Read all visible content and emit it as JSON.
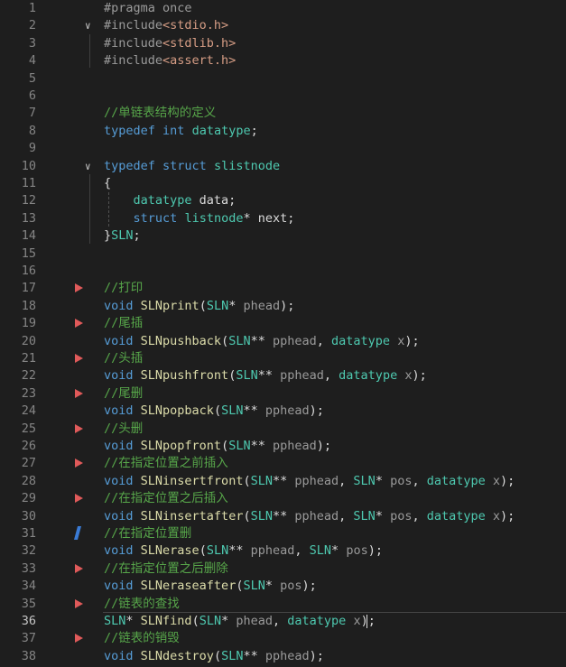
{
  "editor": {
    "current_line": 36,
    "lines": [
      {
        "n": "1",
        "tokens": [
          [
            "pp",
            "#pragma once"
          ]
        ]
      },
      {
        "n": "2",
        "fold": "open",
        "tokens": [
          [
            "pp",
            "#include"
          ],
          [
            "str",
            "<stdio.h>"
          ]
        ]
      },
      {
        "n": "3",
        "tokens": [
          [
            "pp",
            "#include"
          ],
          [
            "str",
            "<stdlib.h>"
          ]
        ]
      },
      {
        "n": "4",
        "tokens": [
          [
            "pp",
            "#include"
          ],
          [
            "str",
            "<assert.h>"
          ]
        ]
      },
      {
        "n": "5",
        "tokens": []
      },
      {
        "n": "6",
        "tokens": []
      },
      {
        "n": "7",
        "tokens": [
          [
            "cm",
            "//单链表结构的定义"
          ]
        ]
      },
      {
        "n": "8",
        "tokens": [
          [
            "kw",
            "typedef"
          ],
          [
            "vr",
            " "
          ],
          [
            "kw",
            "int"
          ],
          [
            "vr",
            " "
          ],
          [
            "ty",
            "datatype"
          ],
          [
            "vr",
            ";"
          ]
        ]
      },
      {
        "n": "9",
        "tokens": []
      },
      {
        "n": "10",
        "fold": "open",
        "tokens": [
          [
            "kw",
            "typedef"
          ],
          [
            "vr",
            " "
          ],
          [
            "kw",
            "struct"
          ],
          [
            "vr",
            " "
          ],
          [
            "ty",
            "slistnode"
          ]
        ]
      },
      {
        "n": "11",
        "tokens": [
          [
            "vr",
            "{"
          ]
        ]
      },
      {
        "n": "12",
        "tokens": [
          [
            "vr",
            "    "
          ],
          [
            "ty",
            "datatype"
          ],
          [
            "vr",
            " data;"
          ]
        ]
      },
      {
        "n": "13",
        "tokens": [
          [
            "vr",
            "    "
          ],
          [
            "kw",
            "struct"
          ],
          [
            "vr",
            " "
          ],
          [
            "ty",
            "listnode"
          ],
          [
            "vr",
            "* next;"
          ]
        ]
      },
      {
        "n": "14",
        "tokens": [
          [
            "vr",
            "}"
          ],
          [
            "ty",
            "SLN"
          ],
          [
            "vr",
            ";"
          ]
        ]
      },
      {
        "n": "15",
        "tokens": []
      },
      {
        "n": "16",
        "tokens": []
      },
      {
        "n": "17",
        "mark": "tri",
        "tokens": [
          [
            "cm",
            "//打印"
          ]
        ]
      },
      {
        "n": "18",
        "tokens": [
          [
            "kw",
            "void"
          ],
          [
            "vr",
            " "
          ],
          [
            "fn",
            "SLNprint"
          ],
          [
            "vr",
            "("
          ],
          [
            "ty",
            "SLN"
          ],
          [
            "vr",
            "* "
          ],
          [
            "pm",
            "phead"
          ],
          [
            "vr",
            ");"
          ]
        ]
      },
      {
        "n": "19",
        "mark": "tri",
        "tokens": [
          [
            "cm",
            "//尾插"
          ]
        ]
      },
      {
        "n": "20",
        "tokens": [
          [
            "kw",
            "void"
          ],
          [
            "vr",
            " "
          ],
          [
            "fn",
            "SLNpushback"
          ],
          [
            "vr",
            "("
          ],
          [
            "ty",
            "SLN"
          ],
          [
            "vr",
            "** "
          ],
          [
            "pm",
            "pphead"
          ],
          [
            "vr",
            ", "
          ],
          [
            "ty",
            "datatype"
          ],
          [
            "vr",
            " "
          ],
          [
            "pm",
            "x"
          ],
          [
            "vr",
            ");"
          ]
        ]
      },
      {
        "n": "21",
        "mark": "tri",
        "tokens": [
          [
            "cm",
            "//头插"
          ]
        ]
      },
      {
        "n": "22",
        "tokens": [
          [
            "kw",
            "void"
          ],
          [
            "vr",
            " "
          ],
          [
            "fn",
            "SLNpushfront"
          ],
          [
            "vr",
            "("
          ],
          [
            "ty",
            "SLN"
          ],
          [
            "vr",
            "** "
          ],
          [
            "pm",
            "pphead"
          ],
          [
            "vr",
            ", "
          ],
          [
            "ty",
            "datatype"
          ],
          [
            "vr",
            " "
          ],
          [
            "pm",
            "x"
          ],
          [
            "vr",
            ");"
          ]
        ]
      },
      {
        "n": "23",
        "mark": "tri",
        "tokens": [
          [
            "cm",
            "//尾删"
          ]
        ]
      },
      {
        "n": "24",
        "tokens": [
          [
            "kw",
            "void"
          ],
          [
            "vr",
            " "
          ],
          [
            "fn",
            "SLNpopback"
          ],
          [
            "vr",
            "("
          ],
          [
            "ty",
            "SLN"
          ],
          [
            "vr",
            "** "
          ],
          [
            "pm",
            "pphead"
          ],
          [
            "vr",
            ");"
          ]
        ]
      },
      {
        "n": "25",
        "mark": "tri",
        "tokens": [
          [
            "cm",
            "//头删"
          ]
        ]
      },
      {
        "n": "26",
        "tokens": [
          [
            "kw",
            "void"
          ],
          [
            "vr",
            " "
          ],
          [
            "fn",
            "SLNpopfront"
          ],
          [
            "vr",
            "("
          ],
          [
            "ty",
            "SLN"
          ],
          [
            "vr",
            "** "
          ],
          [
            "pm",
            "pphead"
          ],
          [
            "vr",
            ");"
          ]
        ]
      },
      {
        "n": "27",
        "mark": "tri",
        "tokens": [
          [
            "cm",
            "//在指定位置之前插入"
          ]
        ]
      },
      {
        "n": "28",
        "tokens": [
          [
            "kw",
            "void"
          ],
          [
            "vr",
            " "
          ],
          [
            "fn",
            "SLNinsertfront"
          ],
          [
            "vr",
            "("
          ],
          [
            "ty",
            "SLN"
          ],
          [
            "vr",
            "** "
          ],
          [
            "pm",
            "pphead"
          ],
          [
            "vr",
            ", "
          ],
          [
            "ty",
            "SLN"
          ],
          [
            "vr",
            "* "
          ],
          [
            "pm",
            "pos"
          ],
          [
            "vr",
            ", "
          ],
          [
            "ty",
            "datatype"
          ],
          [
            "vr",
            " "
          ],
          [
            "pm",
            "x"
          ],
          [
            "vr",
            ");"
          ]
        ]
      },
      {
        "n": "29",
        "mark": "tri",
        "tokens": [
          [
            "cm",
            "//在指定位置之后插入"
          ]
        ]
      },
      {
        "n": "30",
        "tokens": [
          [
            "kw",
            "void"
          ],
          [
            "vr",
            " "
          ],
          [
            "fn",
            "SLNinsertafter"
          ],
          [
            "vr",
            "("
          ],
          [
            "ty",
            "SLN"
          ],
          [
            "vr",
            "** "
          ],
          [
            "pm",
            "pphead"
          ],
          [
            "vr",
            ", "
          ],
          [
            "ty",
            "SLN"
          ],
          [
            "vr",
            "* "
          ],
          [
            "pm",
            "pos"
          ],
          [
            "vr",
            ", "
          ],
          [
            "ty",
            "datatype"
          ],
          [
            "vr",
            " "
          ],
          [
            "pm",
            "x"
          ],
          [
            "vr",
            ");"
          ]
        ]
      },
      {
        "n": "31",
        "mark": "pen",
        "tokens": [
          [
            "cm",
            "//在指定位置删"
          ]
        ]
      },
      {
        "n": "32",
        "tokens": [
          [
            "kw",
            "void"
          ],
          [
            "vr",
            " "
          ],
          [
            "fn",
            "SLNerase"
          ],
          [
            "vr",
            "("
          ],
          [
            "ty",
            "SLN"
          ],
          [
            "vr",
            "** "
          ],
          [
            "pm",
            "pphead"
          ],
          [
            "vr",
            ", "
          ],
          [
            "ty",
            "SLN"
          ],
          [
            "vr",
            "* "
          ],
          [
            "pm",
            "pos"
          ],
          [
            "vr",
            ");"
          ]
        ]
      },
      {
        "n": "33",
        "mark": "tri",
        "tokens": [
          [
            "cm",
            "//在指定位置之后删除"
          ]
        ]
      },
      {
        "n": "34",
        "tokens": [
          [
            "kw",
            "void"
          ],
          [
            "vr",
            " "
          ],
          [
            "fn",
            "SLNeraseafter"
          ],
          [
            "vr",
            "("
          ],
          [
            "ty",
            "SLN"
          ],
          [
            "vr",
            "* "
          ],
          [
            "pm",
            "pos"
          ],
          [
            "vr",
            ");"
          ]
        ]
      },
      {
        "n": "35",
        "mark": "tri",
        "tokens": [
          [
            "cm",
            "//链表的查找"
          ]
        ]
      },
      {
        "n": "36",
        "tokens": [
          [
            "ty",
            "SLN"
          ],
          [
            "vr",
            "* "
          ],
          [
            "fn",
            "SLNfind"
          ],
          [
            "vr",
            "("
          ],
          [
            "ty",
            "SLN"
          ],
          [
            "vr",
            "* "
          ],
          [
            "pm",
            "phead"
          ],
          [
            "vr",
            ", "
          ],
          [
            "ty",
            "datatype"
          ],
          [
            "vr",
            " "
          ],
          [
            "pm",
            "x"
          ],
          [
            "vr",
            ");"
          ]
        ]
      },
      {
        "n": "37",
        "mark": "tri",
        "tokens": [
          [
            "cm",
            "//链表的销毁"
          ]
        ]
      },
      {
        "n": "38",
        "tokens": [
          [
            "kw",
            "void"
          ],
          [
            "vr",
            " "
          ],
          [
            "fn",
            "SLNdestroy"
          ],
          [
            "vr",
            "("
          ],
          [
            "ty",
            "SLN"
          ],
          [
            "vr",
            "** "
          ],
          [
            "pm",
            "pphead"
          ],
          [
            "vr",
            ");"
          ]
        ]
      }
    ]
  }
}
